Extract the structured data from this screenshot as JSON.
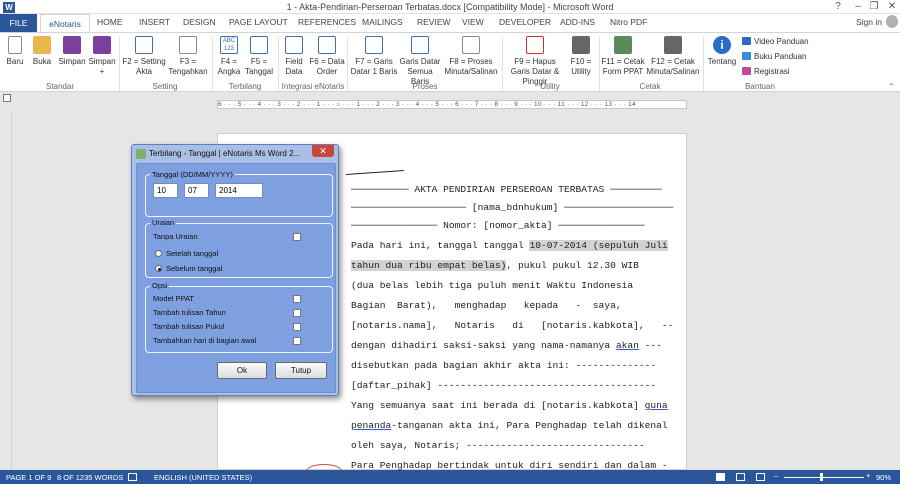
{
  "window": {
    "title": "1 - Akta-Pendirian-Perseroan Terbatas.docx [Compatibility Mode] - Microsoft Word",
    "app_icon": "W",
    "sign_in": "Sign in"
  },
  "tabs": [
    "FILE",
    "eNotaris",
    "HOME",
    "INSERT",
    "DESIGN",
    "PAGE LAYOUT",
    "REFERENCES",
    "MAILINGS",
    "REVIEW",
    "VIEW",
    "DEVELOPER",
    "ADD-INS",
    "Nitro PDF"
  ],
  "ribbon": {
    "buttons": [
      {
        "label": "Baru",
        "icon": "new-document-icon"
      },
      {
        "label": "Buka",
        "icon": "folder-open-icon"
      },
      {
        "label": "Simpan",
        "icon": "save-icon"
      },
      {
        "label": "Simpan +",
        "icon": "save-as-icon"
      },
      {
        "label": "F2 = Setting Akta",
        "icon": "grid-settings-icon"
      },
      {
        "label": "F3 = Tengahkan",
        "icon": "center-align-icon"
      },
      {
        "label": "F4 = Angka",
        "icon": "abc-123-icon"
      },
      {
        "label": "F5 = Tanggal",
        "icon": "calendar-icon"
      },
      {
        "label": "Field Data",
        "icon": "field-data-icon"
      },
      {
        "label": "F6 = Data Order",
        "icon": "data-order-icon"
      },
      {
        "label": "F7 = Garis Datar 1 Baris",
        "icon": "line-one-icon"
      },
      {
        "label": "Garis Datar Semua Baris",
        "icon": "line-all-icon"
      },
      {
        "label": "F8 = Proses Minuta/Salinan",
        "icon": "process-icon"
      },
      {
        "label": "F9 = Hapus Garis Datar & Pinggir",
        "icon": "delete-lines-icon"
      },
      {
        "label": "F10 = Utility",
        "icon": "tools-icon"
      },
      {
        "label": "F11 = Cetak Form PPAT",
        "icon": "print-form-icon"
      },
      {
        "label": "F12 = Cetak Minuta/Salinan",
        "icon": "printer-icon"
      },
      {
        "label": "Tentang",
        "icon": "info-icon"
      }
    ],
    "small": [
      "Video Panduan",
      "Buku Panduan",
      "Registrasi"
    ],
    "groups": [
      "Standar",
      "Setting",
      "Terbilang",
      "Integrasi eNotaris",
      "Proses",
      "Utility",
      "Cetak",
      "Bantuan"
    ]
  },
  "ruler": "6 · · · 5 · · · 4 · · · 3 · · · 2 · · · 1 · · · ⌂ · · · 1 · · · 2 · · · 3 · · · 4 · · · 5 · · · 6 · · · 7 · · · 8 · · · 9 · · · 10 · · · 11 · · · 12 · · · 13 · · · 14",
  "document": {
    "heading": "────────── AKTA PENDIRIAN PERSEROAN TERBATAS ─────────",
    "name_line": "──────────────────── [nama_bdnhukum] ───────────────────",
    "number_line": "─────────────── Nomor: [nomor_akta] ───────────────",
    "p1a": "Pada hari ini, tanggal tanggal ",
    "p1b": "10-07-2014 (sepuluh Juli",
    "p2a": "tahun dua ribu empat belas)",
    "p2b": ", pukul pukul 12.30 WIB",
    "p3": "(dua belas lebih tiga puluh menit Waktu Indonesia",
    "p4": "Bagian  Barat),   menghadap   kepada   -  saya,",
    "p5": "[notaris.nama],   Notaris   di   [notaris.kabkota],   --",
    "p6a": "dengan dihadiri saksi-saksi yang nama-namanya ",
    "p6b": "akan",
    "p6c": " ---",
    "p7": "disebutkan pada bagian akhir akta ini: --------------",
    "p8": "[daftar_pihak] --------------------------------------",
    "p9a": "Yang semuanya saat ini berada di [notaris.kabkota] ",
    "p9b": "guna",
    "p10a": "penanda",
    "p10b": "-tanganan akta ini, Para Penghadap telah dikenal",
    "p11": "oleh saya, Notaris; -------------------------------",
    "p12": "Para Penghadap bertindak untuk diri sendiri dan dalam -"
  },
  "dialog": {
    "title": "Terbilang - Tanggal | eNotaris Ms Word 2...",
    "close": "✕",
    "date_legend": "Tanggal (DD/MM/YYYY)",
    "day": "10",
    "month": "07",
    "year": "2014",
    "uraian_legend": "Uraian",
    "tanpa_uraian": "Tanpa Uraian",
    "setelah": "Setelah tanggal",
    "sebelum": "Sebelum tanggal",
    "opsi_legend": "Opsi",
    "opt1": "Model PPAT",
    "opt2": "Tambah tulisan Tahun",
    "opt3": "Tambah tulisan Pukul",
    "opt4": "Tambahkan hari di bagian awal",
    "ok": "Ok",
    "tutup": "Tutup"
  },
  "status": {
    "page": "PAGE 1 OF 9",
    "words": "8 OF 1235 WORDS",
    "language": "ENGLISH (UNITED STATES)",
    "zoom": "90%"
  },
  "colors": {
    "accent": "#2b579a",
    "dialog_bg": "#7fa0e0",
    "highlight": "#d2d2d2"
  }
}
